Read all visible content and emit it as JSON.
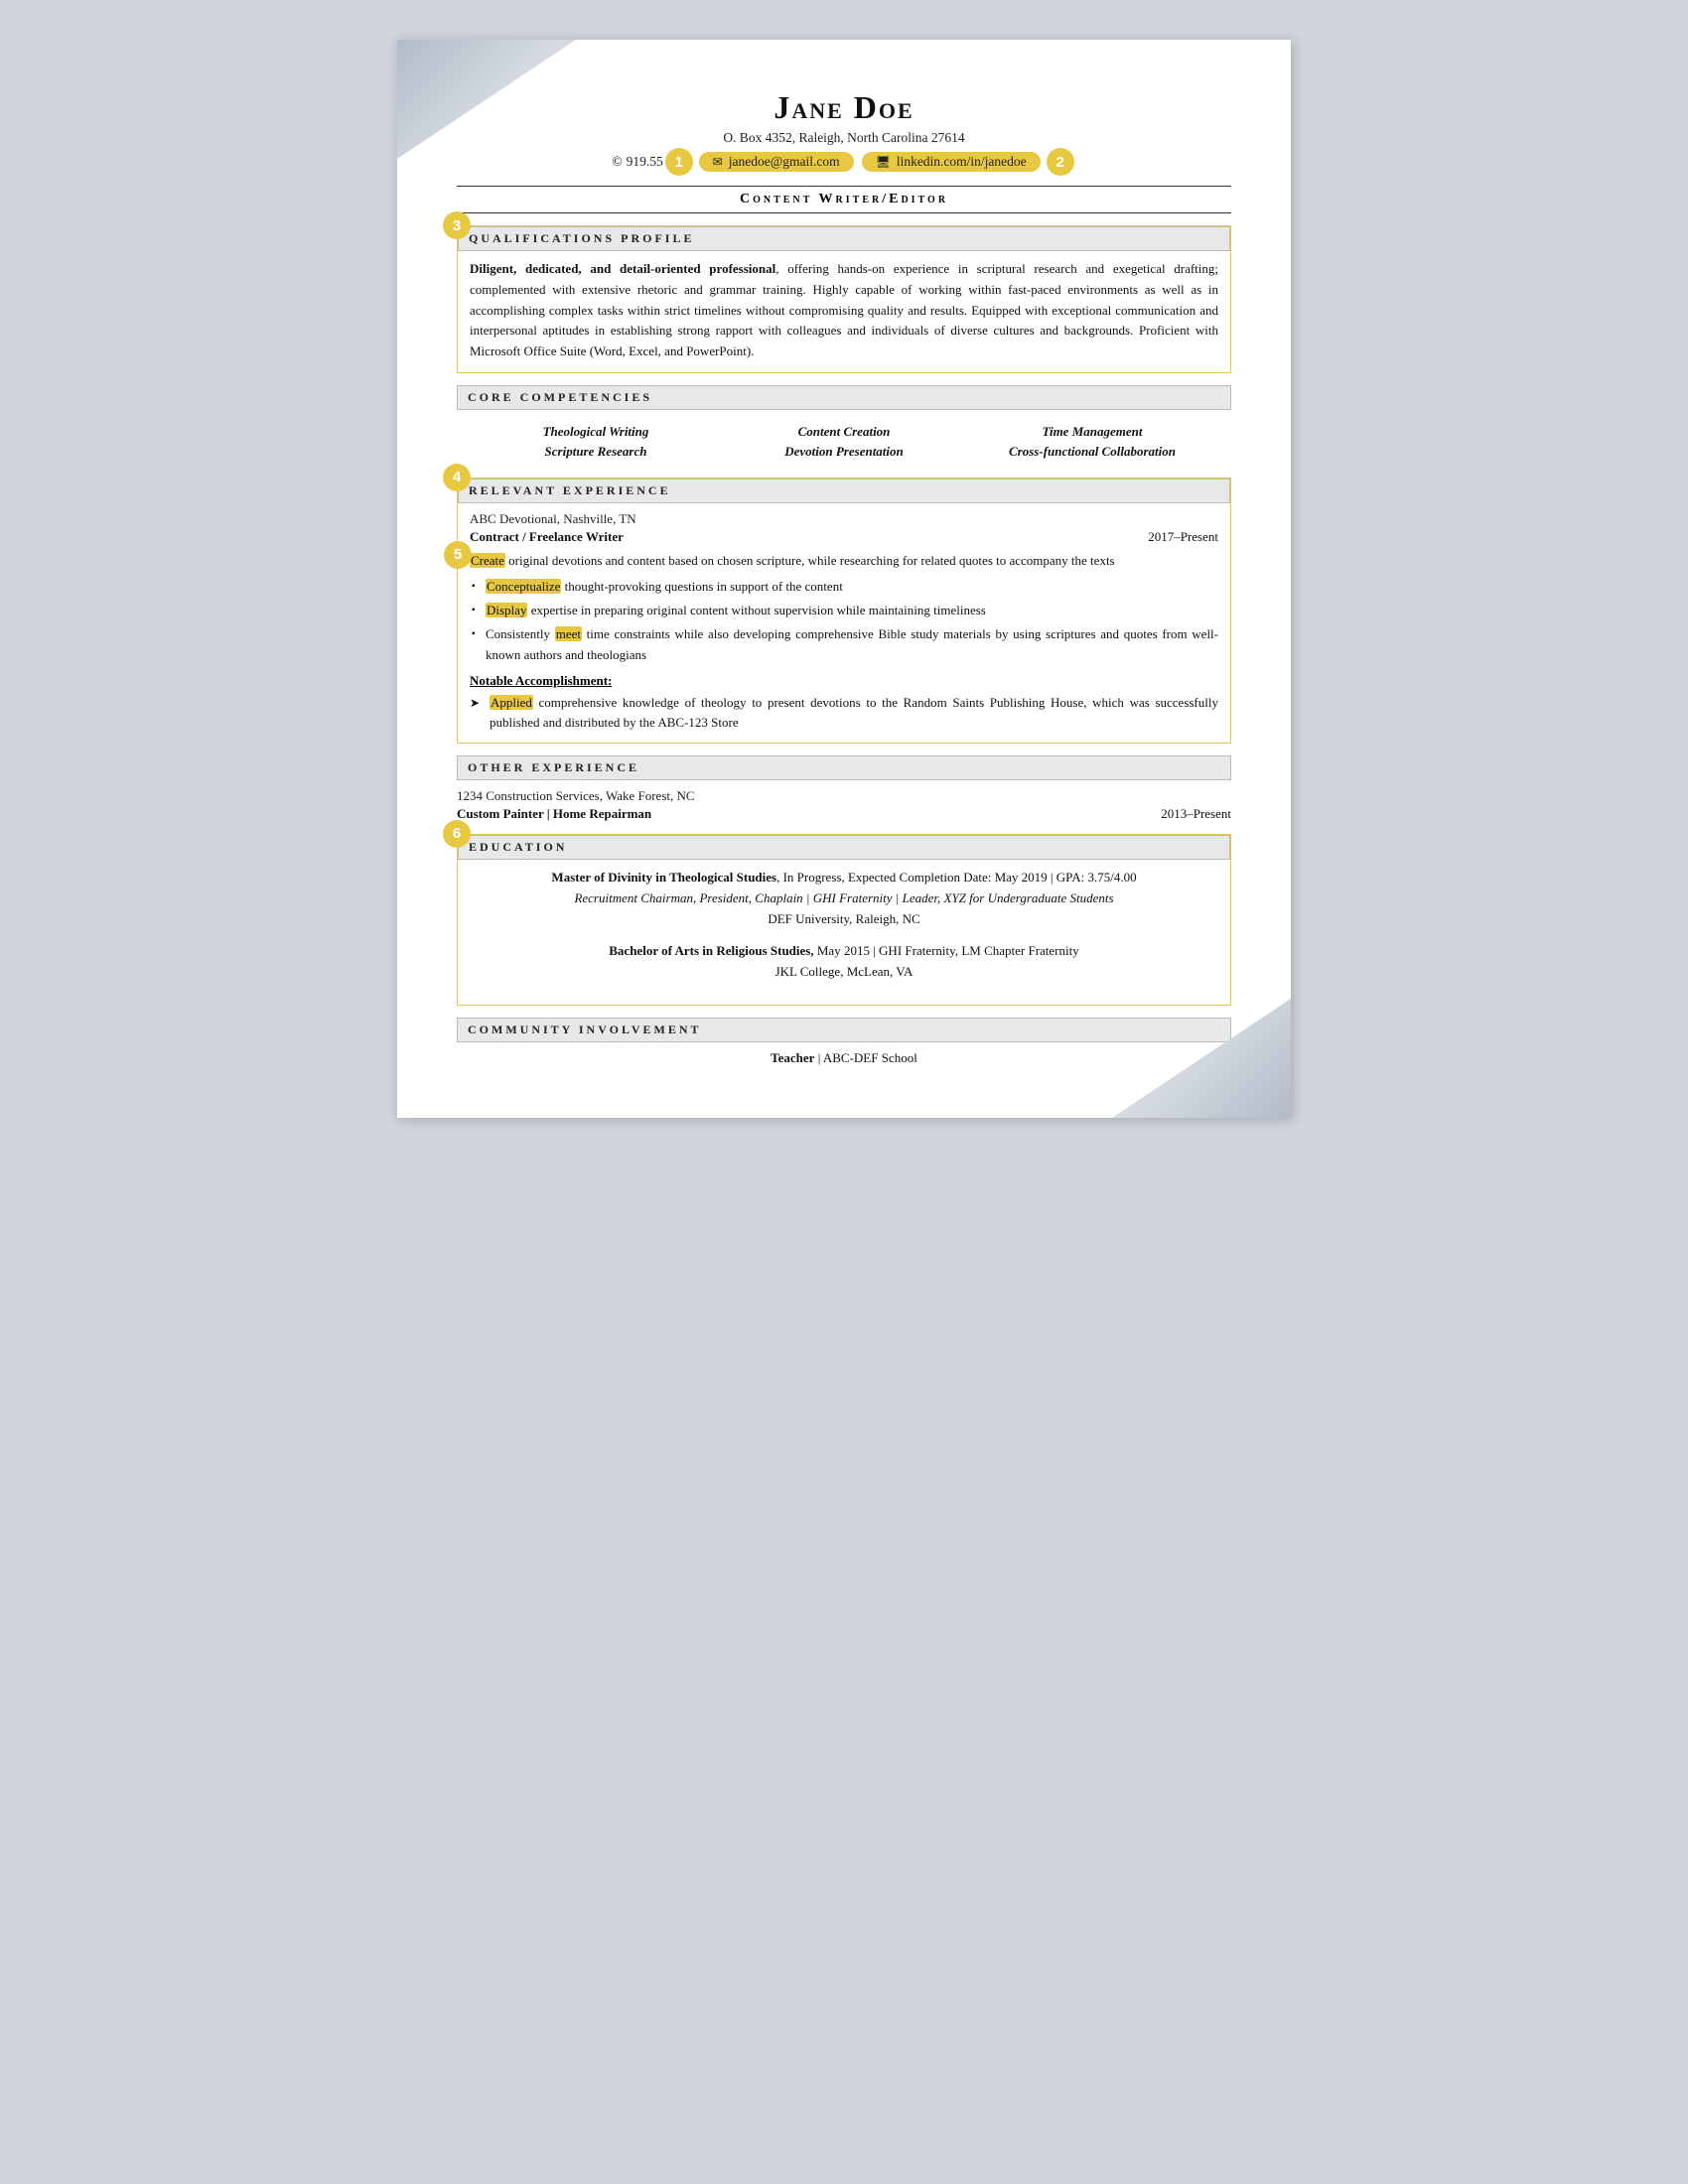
{
  "header": {
    "name": "Jane Doe",
    "address": "O. Box 4352, Raleigh, North Carolina 27614",
    "phone_icon": "©",
    "phone": "919.55",
    "email_icon": "✉",
    "email": "janedoe@gmail.com",
    "linkedin_icon": "🖥",
    "linkedin": "linkedin.com/in/janedoe"
  },
  "job_title": "Content Writer/Editor",
  "sections": {
    "qualifications": {
      "header": "Qualifications Profile",
      "text_bold": "Diligent, dedicated, and detail-oriented professional",
      "text_rest": ", offering hands-on experience in scriptural research and exegetical drafting; complemented with extensive rhetoric and grammar training. Highly capable of working within fast-paced environments as well as in accomplishing complex tasks within strict timelines without compromising quality and results. Equipped with exceptional communication and interpersonal aptitudes in establishing strong rapport with colleagues and individuals of diverse cultures and backgrounds. Proficient with Microsoft Office Suite (Word, Excel, and PowerPoint)."
    },
    "competencies": {
      "header": "Core Competencies",
      "items": [
        "Theological Writing",
        "Content Creation",
        "Time Management",
        "Scripture Research",
        "Devotion Presentation",
        "Cross-functional Collaboration"
      ]
    },
    "relevant_experience": {
      "header": "Relevant Experience",
      "company": "ABC Devotional, Nashville, TN",
      "title": "Contract / Freelance Writer",
      "date": "2017–Present",
      "main_bullet": "Create original devotions and content based on chosen scripture, while researching for related quotes to accompany the texts",
      "bullets": [
        "Conceptualize thought-provoking questions in support of the content",
        "Display expertise in preparing original content without supervision while maintaining timeliness",
        "Consistently meet time constraints while also developing comprehensive Bible study materials by using scriptures and quotes from well-known authors and theologians"
      ],
      "notable_title": "Notable Accomplishment:",
      "notable_bullets": [
        "Applied comprehensive knowledge of theology to present devotions to the Random Saints Publishing House, which was successfully published and distributed by the ABC-123 Store"
      ]
    },
    "other_experience": {
      "header": "Other Experience",
      "company": "1234 Construction Services, Wake Forest, NC",
      "title": "Custom Painter | Home Repairman",
      "date": "2013–Present"
    },
    "education": {
      "header": "Education",
      "entries": [
        {
          "degree_bold": "Master of Divinity in Theological Studies",
          "degree_rest": ", In Progress, Expected Completion Date: May 2019 | GPA: 3.75/4.00",
          "line2": "Recruitment Chairman, President, Chaplain | GHI Fraternity | Leader, XYZ for Undergraduate Students",
          "line3": "DEF University, Raleigh, NC"
        },
        {
          "degree_bold": "Bachelor of Arts in Religious Studies,",
          "degree_rest": " May 2015 | GHI Fraternity, LM Chapter Fraternity",
          "line2": "JKL College, McLean, VA"
        }
      ]
    },
    "community": {
      "header": "Community Involvement",
      "row": "Teacher | ABC-DEF School"
    }
  },
  "badges": {
    "b1": "1",
    "b2": "2",
    "b3": "3",
    "b4": "4",
    "b5": "5",
    "b6": "6"
  }
}
